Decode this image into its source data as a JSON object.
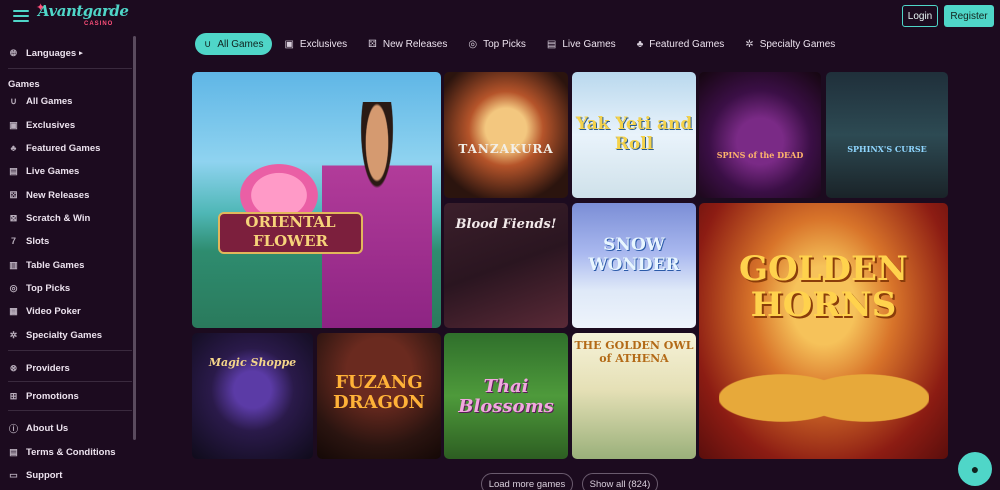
{
  "header": {
    "logo_text": "Avantgarde",
    "logo_sub": "CASINO",
    "login_label": "Login",
    "register_label": "Register"
  },
  "sidebar": {
    "languages": "Languages",
    "games_heading": "Games",
    "items": [
      {
        "label": "All Games",
        "icon": "horseshoe-icon"
      },
      {
        "label": "Exclusives",
        "icon": "exclusive-icon"
      },
      {
        "label": "Featured Games",
        "icon": "clover-icon"
      },
      {
        "label": "Live Games",
        "icon": "cards-icon"
      },
      {
        "label": "New Releases",
        "icon": "dice-icon"
      },
      {
        "label": "Scratch & Win",
        "icon": "scratch-icon"
      },
      {
        "label": "Slots",
        "icon": "seven-icon"
      },
      {
        "label": "Table Games",
        "icon": "table-icon"
      },
      {
        "label": "Top Picks",
        "icon": "chip-icon"
      },
      {
        "label": "Video Poker",
        "icon": "poker-icon"
      },
      {
        "label": "Specialty Games",
        "icon": "star-icon"
      }
    ],
    "providers": "Providers",
    "promotions": "Promotions",
    "about": "About Us",
    "terms": "Terms & Conditions",
    "support": "Support"
  },
  "tabs": [
    {
      "label": "All Games",
      "active": true
    },
    {
      "label": "Exclusives",
      "active": false
    },
    {
      "label": "New Releases",
      "active": false
    },
    {
      "label": "Top Picks",
      "active": false
    },
    {
      "label": "Live Games",
      "active": false
    },
    {
      "label": "Featured Games",
      "active": false
    },
    {
      "label": "Specialty Games",
      "active": false
    }
  ],
  "games": {
    "oriental": "ORIENTAL FLOWER",
    "tanzakura": "TANZAKURA",
    "yakyeti": "Yak Yeti and Roll",
    "spins": "SPINS of the DEAD",
    "sphinx": "SPHINX'S CURSE",
    "bloodfiends": "Blood Fiends!",
    "snow": "SNOW WONDER",
    "golden": "GOLDEN HORNS",
    "magic": "Magic Shoppe",
    "fuzang": "FUZANG DRAGON",
    "thai": "Thai Blossoms",
    "owl": "THE GOLDEN OWL of ATHENA"
  },
  "actions": {
    "load_more": "Load more games",
    "show_all": "Show all (824)"
  },
  "colors": {
    "accent": "#4fd6c8",
    "background": "#1c0b1f"
  }
}
